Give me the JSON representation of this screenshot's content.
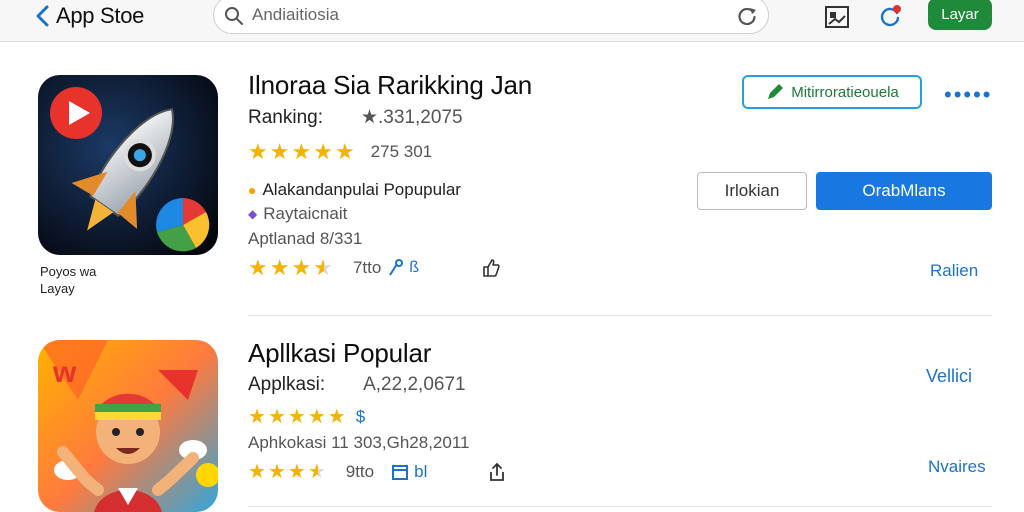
{
  "topbar": {
    "back_label": "App Stoe",
    "search_placeholder": "Andiaitiosia",
    "action_button": "Layar"
  },
  "apps": [
    {
      "title": "Ilnoraa Sia Rarikking Jan",
      "ranking_label": "Ranking:",
      "ranking_value": "★.331,2075",
      "rating_value": 5,
      "rating_text": "275 301",
      "category": "Alakandanpulai Popupular",
      "developer": "Raytaicnait",
      "meta": "Aptlanad 8/331",
      "rating2_value": 3.5,
      "count": "7tto",
      "icon_caption_line1": "Poyos wa",
      "icon_caption_line2": "Layay",
      "badge_label": "Mitirroratieouela",
      "secondary_button": "Irlokian",
      "primary_button": "OrabMlans",
      "side_link": "Ralien",
      "more_label": "•••••"
    },
    {
      "title": "Apllkasi Popular",
      "ranking_label": "Applkasi:",
      "ranking_value": "A,22,2,0671",
      "rating_value": 5,
      "price_symbol": "$",
      "meta": "Aphkokasi 11 303,Gh28,2011",
      "rating2_value": 3.5,
      "count": "9tto",
      "count_suffix": "bl",
      "top_link": "Vellici",
      "side_link": "Nvaires"
    }
  ],
  "colors": {
    "accent_blue": "#1877e0",
    "accent_green": "#1e8a3a",
    "star": "#f5b301"
  }
}
